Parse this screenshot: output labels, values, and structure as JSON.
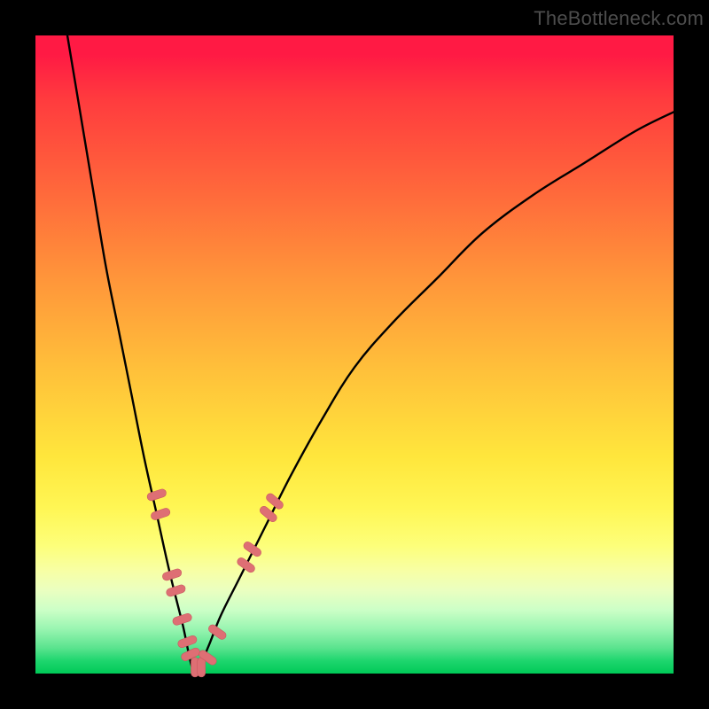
{
  "watermark": "TheBottleneck.com",
  "colors": {
    "frame": "#000000",
    "curve": "#000000",
    "marker_fill": "#de6f74",
    "marker_stroke": "#c95a60"
  },
  "chart_data": {
    "type": "line",
    "title": "",
    "xlabel": "",
    "ylabel": "",
    "xlim": [
      0,
      100
    ],
    "ylim": [
      0,
      100
    ],
    "grid": false,
    "legend": false,
    "notes": "V-shaped bottleneck curve over vertical red→yellow→green gradient. No axis tick labels are shown; values are read off relative to the 0–100 plot area. The curve minimum (zero bottleneck) is near x≈25. Highlighted pill markers cluster around the valley on both arms.",
    "background_gradient": {
      "direction": "top_to_bottom",
      "stops": [
        {
          "pos": 0,
          "color": "#ff1a44"
        },
        {
          "pos": 25,
          "color": "#ff6a3b"
        },
        {
          "pos": 50,
          "color": "#ffbf3a"
        },
        {
          "pos": 75,
          "color": "#fff654"
        },
        {
          "pos": 90,
          "color": "#ccffc7"
        },
        {
          "pos": 100,
          "color": "#00c957"
        }
      ]
    },
    "series": [
      {
        "name": "bottleneck_curve",
        "x": [
          5,
          7,
          9,
          11,
          13,
          15,
          17,
          19,
          21,
          23,
          25,
          27,
          29,
          32,
          36,
          40,
          45,
          50,
          56,
          63,
          70,
          78,
          86,
          94,
          100
        ],
        "y": [
          100,
          88,
          76,
          64,
          54,
          44,
          34,
          25,
          16,
          8,
          0,
          4,
          9,
          15,
          23,
          31,
          40,
          48,
          55,
          62,
          69,
          75,
          80,
          85,
          88
        ]
      }
    ],
    "markers": [
      {
        "shape": "pill",
        "x": 19.0,
        "y": 28.0,
        "angle": 72
      },
      {
        "shape": "pill",
        "x": 19.6,
        "y": 25.0,
        "angle": 72
      },
      {
        "shape": "pill",
        "x": 21.4,
        "y": 15.5,
        "angle": 72
      },
      {
        "shape": "pill",
        "x": 22.0,
        "y": 13.0,
        "angle": 72
      },
      {
        "shape": "pill",
        "x": 23.0,
        "y": 8.5,
        "angle": 72
      },
      {
        "shape": "pill",
        "x": 23.8,
        "y": 5.0,
        "angle": 70
      },
      {
        "shape": "pill",
        "x": 24.3,
        "y": 3.0,
        "angle": 65
      },
      {
        "shape": "pill",
        "x": 25.0,
        "y": 1.0,
        "angle": 0
      },
      {
        "shape": "pill",
        "x": 26.0,
        "y": 1.0,
        "angle": 0
      },
      {
        "shape": "pill",
        "x": 27.0,
        "y": 2.5,
        "angle": -55
      },
      {
        "shape": "pill",
        "x": 28.5,
        "y": 6.5,
        "angle": -55
      },
      {
        "shape": "pill",
        "x": 33.0,
        "y": 17.0,
        "angle": -55
      },
      {
        "shape": "pill",
        "x": 34.0,
        "y": 19.5,
        "angle": -55
      },
      {
        "shape": "pill",
        "x": 36.5,
        "y": 25.0,
        "angle": -50
      },
      {
        "shape": "pill",
        "x": 37.5,
        "y": 27.0,
        "angle": -50
      }
    ]
  }
}
